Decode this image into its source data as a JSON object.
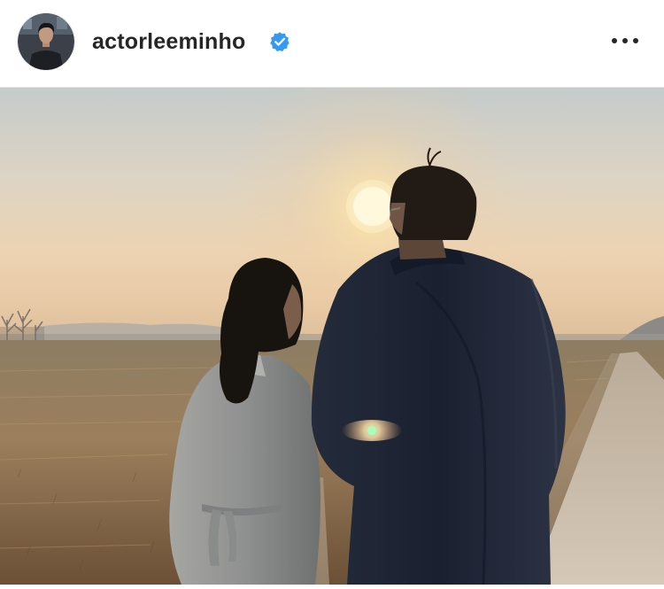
{
  "post": {
    "username": "actorleeminho",
    "verified": true,
    "verified_icon": "verified-badge-icon",
    "more_icon": "more-options-icon",
    "accent_color": "#1da1f2",
    "photo_description_visible_text": ""
  }
}
